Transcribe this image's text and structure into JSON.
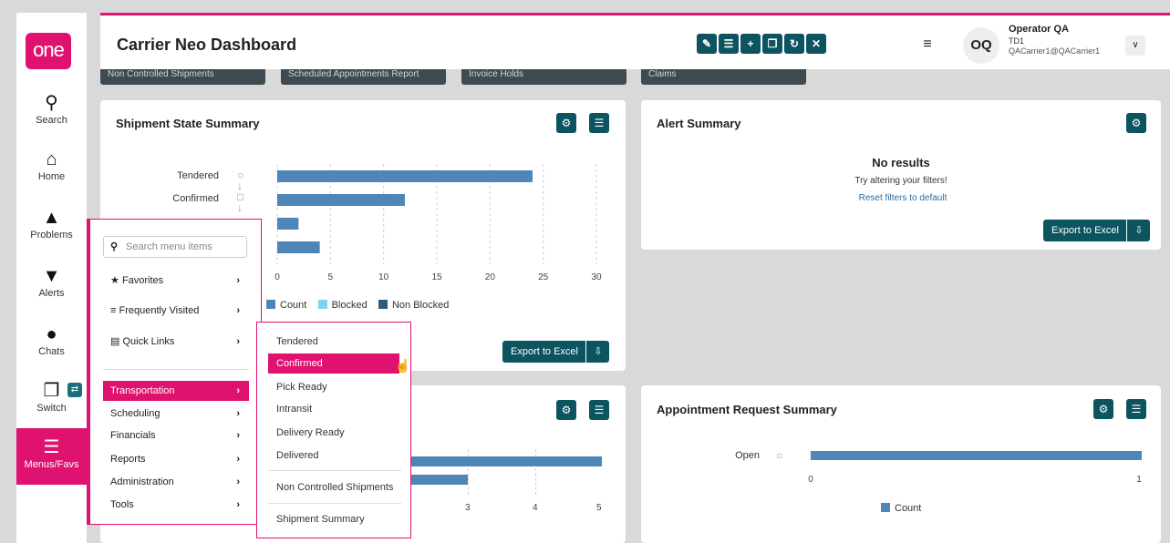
{
  "app": {
    "logo_text": "one",
    "title": "Carrier Neo Dashboard",
    "brand_color": "#e0126f",
    "accent_color": "#0c5460"
  },
  "user": {
    "initials": "OQ",
    "name": "Operator QA",
    "org": "TD1",
    "email": "QACarrier1@QACarrier1"
  },
  "leftnav": [
    {
      "label": "Search",
      "icon": "search-icon"
    },
    {
      "label": "Home",
      "icon": "home-icon"
    },
    {
      "label": "Problems",
      "icon": "warning-icon"
    },
    {
      "label": "Alerts",
      "icon": "bell-icon"
    },
    {
      "label": "Chats",
      "icon": "chat-icon"
    },
    {
      "label": "Switch",
      "icon": "switch-icon"
    },
    {
      "label": "Menus/Favs",
      "icon": "menu-icon"
    }
  ],
  "tiles": [
    "Non Controlled Shipments",
    "Scheduled Appointments Report",
    "Invoice Holds",
    "Claims"
  ],
  "shipment_state": {
    "title": "Shipment State Summary",
    "categories": [
      "Tendered",
      "Confirmed"
    ],
    "ticks": [
      "0",
      "5",
      "10",
      "15",
      "20",
      "25",
      "30"
    ],
    "legend": [
      "Count",
      "Blocked",
      "Non Blocked"
    ],
    "export_label": "Export to Excel"
  },
  "chart_data": [
    {
      "type": "bar",
      "title": "Shipment State Summary",
      "categories": [
        "Tendered",
        "Confirmed"
      ],
      "series": [
        {
          "name": "Count",
          "values": [
            24,
            12,
            2,
            4
          ]
        }
      ],
      "xlim": [
        0,
        30
      ],
      "legend": [
        "Count",
        "Blocked",
        "Non Blocked"
      ],
      "grid": true
    },
    {
      "type": "bar",
      "title": "Appointment Request Summary",
      "categories": [
        "Open"
      ],
      "series": [
        {
          "name": "Count",
          "values": [
            1
          ]
        }
      ],
      "xlim": [
        0,
        1
      ],
      "grid": true
    }
  ],
  "alert_summary": {
    "title": "Alert Summary",
    "no_results": "No results",
    "hint": "Try altering your filters!",
    "reset": "Reset filters to default",
    "export_label": "Export to Excel"
  },
  "lower_left": {
    "ticks": [
      "3",
      "4",
      "5"
    ]
  },
  "appointment": {
    "title": "Appointment Request Summary",
    "category": "Open",
    "ticks": [
      "0",
      "1"
    ],
    "legend": "Count"
  },
  "menu": {
    "search_placeholder": "Search menu items",
    "top_items": [
      "Favorites",
      "Frequently Visited",
      "Quick Links"
    ],
    "items": [
      "Transportation",
      "Scheduling",
      "Financials",
      "Reports",
      "Administration",
      "Tools"
    ]
  },
  "submenu": {
    "items": [
      "Tendered",
      "Confirmed",
      "Pick Ready",
      "Intransit",
      "Delivery Ready",
      "Delivered"
    ],
    "extra": [
      "Non Controlled Shipments",
      "Shipment Summary"
    ]
  }
}
